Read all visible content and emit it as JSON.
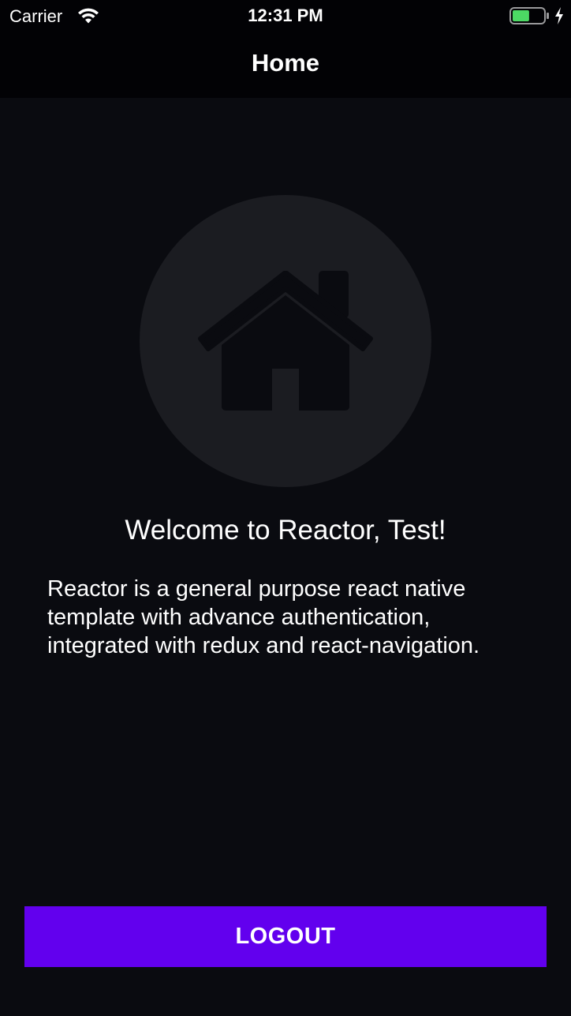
{
  "status_bar": {
    "carrier": "Carrier",
    "time": "12:31 PM",
    "wifi_icon": "wifi-icon",
    "battery_icon": "battery-icon",
    "charging_icon": "charging-bolt-icon",
    "battery_level": 0.55,
    "battery_color": "#4cd964"
  },
  "header": {
    "title": "Home"
  },
  "main": {
    "hero_icon": "home-icon",
    "welcome_text": "Welcome to Reactor, Test!",
    "description": "Reactor is a general purpose react native template with advance authentication, integrated with redux and react-navigation."
  },
  "actions": {
    "logout_label": "LOGOUT"
  },
  "colors": {
    "background": "#0a0b10",
    "header_background": "#020205",
    "accent": "#6200ee",
    "circle": "#1b1c21"
  }
}
